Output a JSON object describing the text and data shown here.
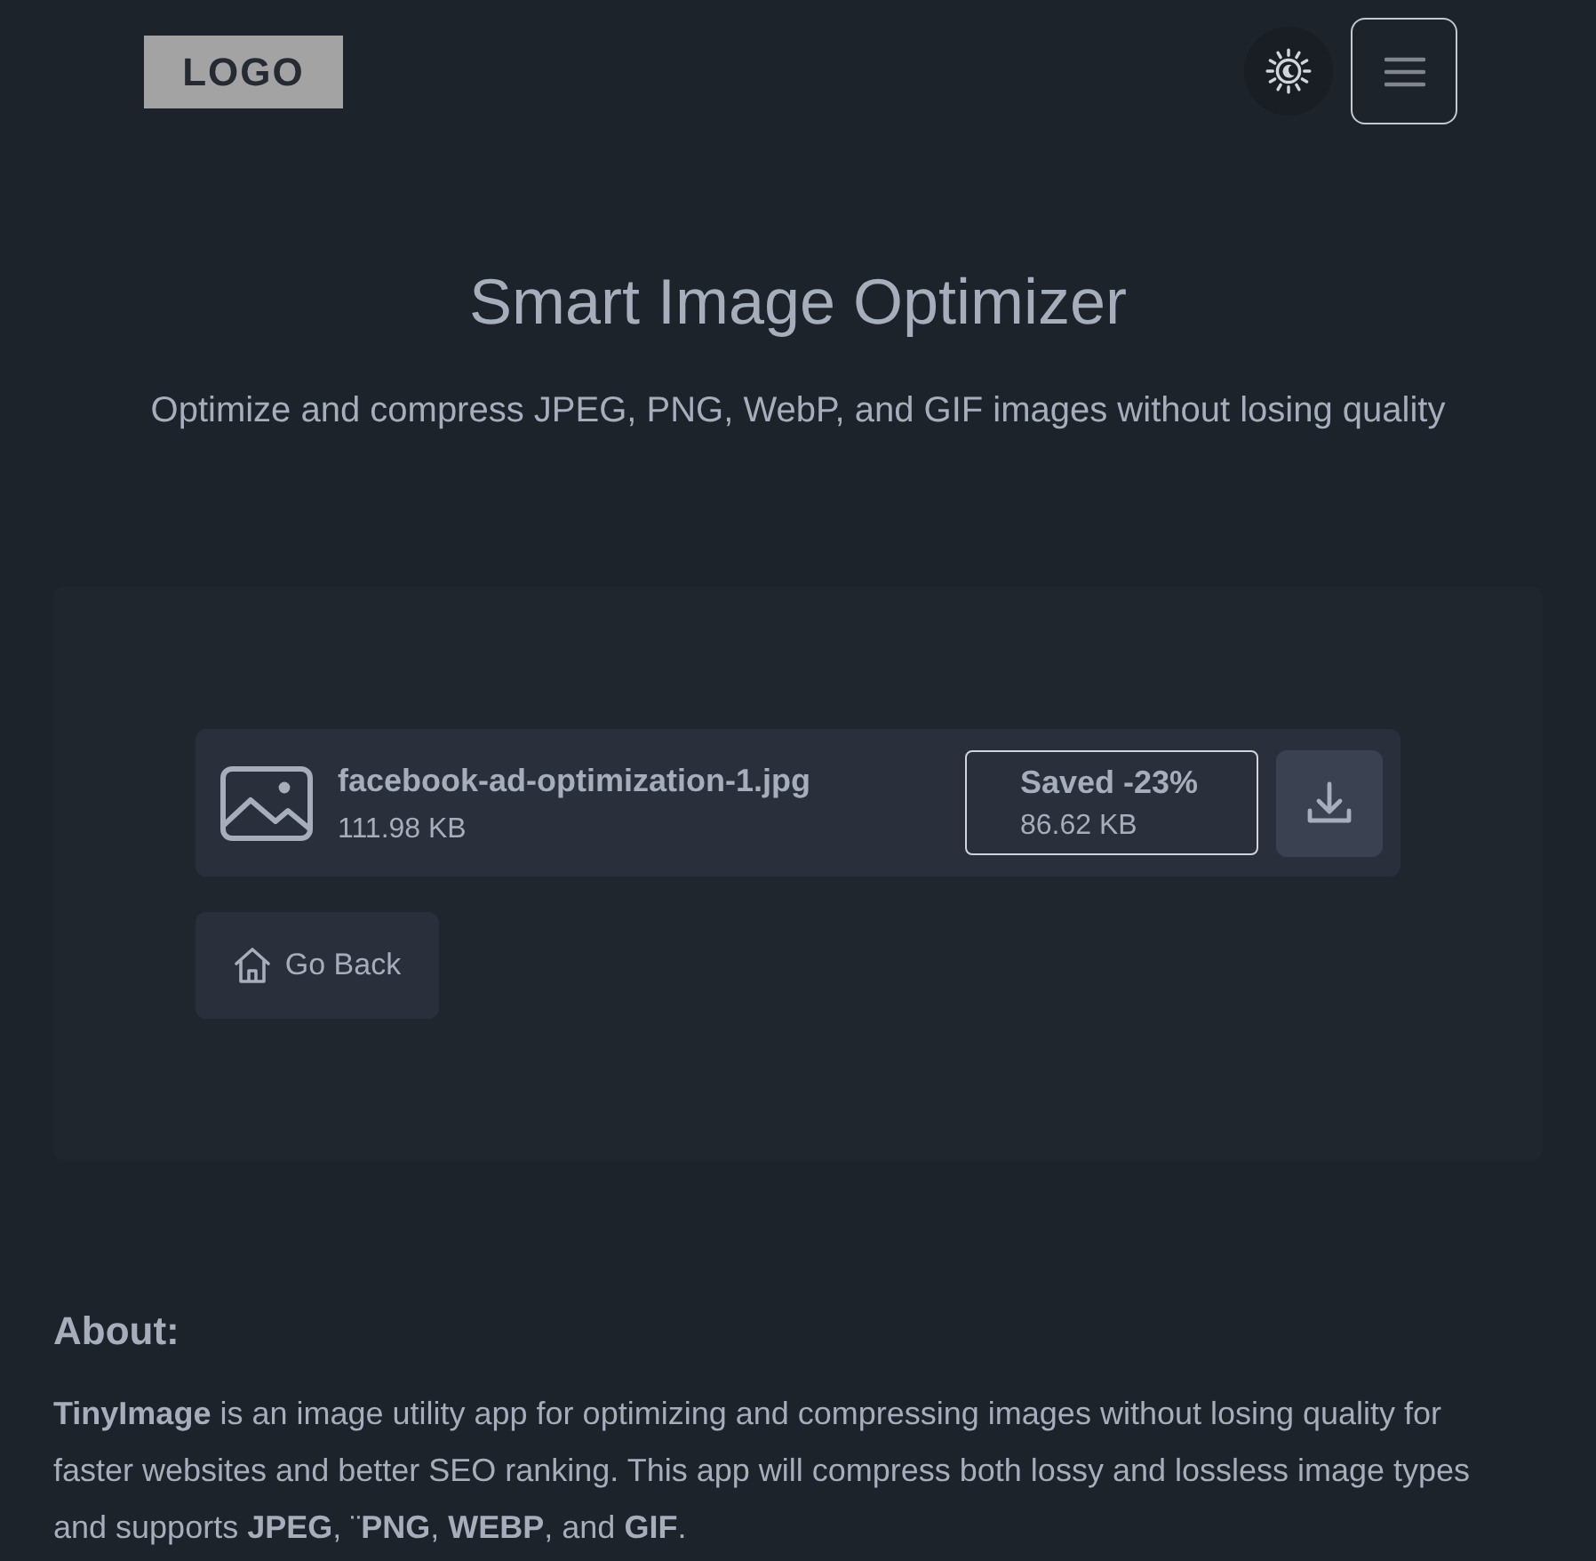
{
  "header": {
    "logo": "LOGO"
  },
  "hero": {
    "title": "Smart Image Optimizer",
    "subtitle": "Optimize and compress JPEG, PNG, WebP, and GIF images without losing quality"
  },
  "results": {
    "files": [
      {
        "name": "facebook-ad-optimization-1.jpg",
        "size": "111.98 KB",
        "saved_label": "Saved -23%",
        "new_size": "86.62 KB"
      }
    ],
    "back_button": "Go Back"
  },
  "about": {
    "heading": "About:",
    "text": "**TinyImage** is an image utility app for optimizing and compressing images without losing quality for faster websites and better SEO ranking. This app will compress both lossy and lossless image types and supports **JPEG**, ¨**PNG**, **WEBP**, and **GIF**."
  }
}
